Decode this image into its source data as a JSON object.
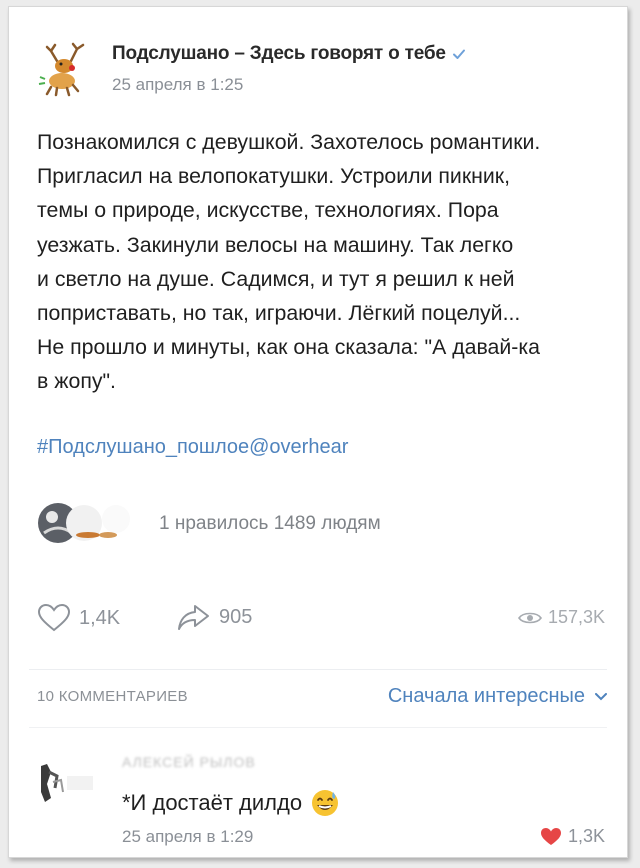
{
  "post": {
    "group_name": "Подслушано – Здесь говорят о тебе",
    "date": "25 апреля в 1:25",
    "text_lines": [
      "Познакомился с девушкой. Захотелось романтики.",
      "Пригласил на велопокатушки. Устроили пикник,",
      "темы о природе, искусстве, технологиях. Пора",
      "уезжать. Закинули велосы на машину. Так легко",
      "и светло на душе. Садимся, и тут я решил к ней",
      "поприставать, но так, играючи. Лёгкий поцелуй...",
      "Не прошло и минуты, как она сказала: \"А давай-ка",
      "в жопу\"."
    ],
    "hashtag": "#Подслушано_пошлое@overhear",
    "liked_text": "1 нравилось 1489 людям",
    "likes": "1,4K",
    "reposts": "905",
    "views": "157,3K"
  },
  "comments": {
    "count_label": "10 КОММЕНТАРИЕВ",
    "sort_label": "Сначала интересные",
    "items": [
      {
        "author": "АЛЕКСЕЙ РЫЛОВ",
        "text": "*И достаёт дилдо",
        "date": "25 апреля в 1:29",
        "likes": "1,3K"
      }
    ]
  },
  "icons": {
    "verified": "checkmark-icon",
    "like": "heart-icon",
    "repost": "share-arrow-icon",
    "views": "eye-icon",
    "sort": "chevron-down-icon",
    "comment_like": "heart-filled-icon",
    "emoji": "sweat-smile-emoji-icon"
  },
  "colors": {
    "link": "#4f83bd",
    "muted": "#8a8f96",
    "heart_active": "#e64646"
  }
}
